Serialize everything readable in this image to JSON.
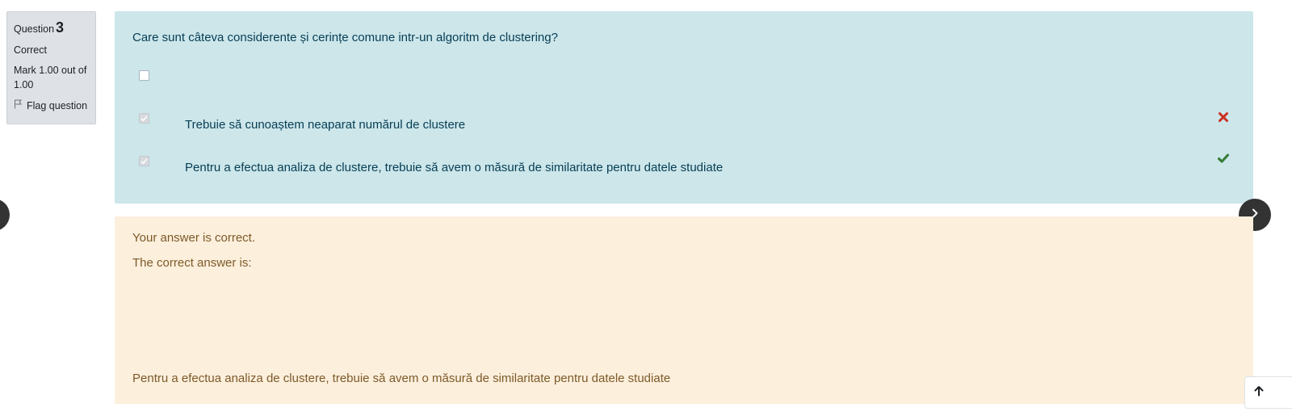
{
  "info": {
    "question_label": "Question",
    "question_number": "3",
    "state": "Correct",
    "grade": "Mark 1.00 out of 1.00",
    "flag_label": "Flag question"
  },
  "question": {
    "text": "Care sunt câteva considerente și cerințe comune intr-un algoritm de clustering?",
    "options": [
      {
        "label": "",
        "checked": false,
        "result": ""
      },
      {
        "label": "Trebuie să cunoaștem neaparat numărul de clustere",
        "checked": true,
        "result": "incorrect"
      },
      {
        "label": "Pentru a efectua analiza de clustere, trebuie să avem o măsură de similaritate pentru datele studiate",
        "checked": true,
        "result": "correct"
      }
    ]
  },
  "feedback": {
    "general": "Your answer is correct.",
    "right_answer_label": "The correct answer is:",
    "right_answer": "Pentru a efectua analiza de clustere, trebuie să avem o măsură de similaritate pentru datele studiate"
  },
  "colors": {
    "formulation_bg": "#cce6ea",
    "outcome_bg": "#fcefdc",
    "incorrect": "#ca3120",
    "correct": "#357a32"
  }
}
